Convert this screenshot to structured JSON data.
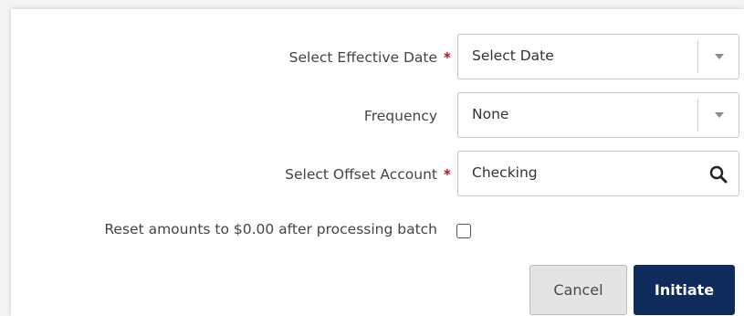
{
  "form": {
    "effective_date": {
      "label": "Select Effective Date",
      "required_mark": "*",
      "value": "Select Date"
    },
    "frequency": {
      "label": "Frequency",
      "value": "None"
    },
    "offset_account": {
      "label": "Select Offset Account",
      "required_mark": "*",
      "value": "Checking"
    },
    "reset_amounts": {
      "label": "Reset amounts to $0.00 after processing batch",
      "checked": false
    }
  },
  "actions": {
    "cancel_label": "Cancel",
    "initiate_label": "Initiate"
  },
  "colors": {
    "primary": "#0f2b5b",
    "required": "#d0021b",
    "secondary_button": "#e4e4e4"
  },
  "icons": {
    "dropdown": "chevron-down-icon",
    "search": "search-icon"
  }
}
